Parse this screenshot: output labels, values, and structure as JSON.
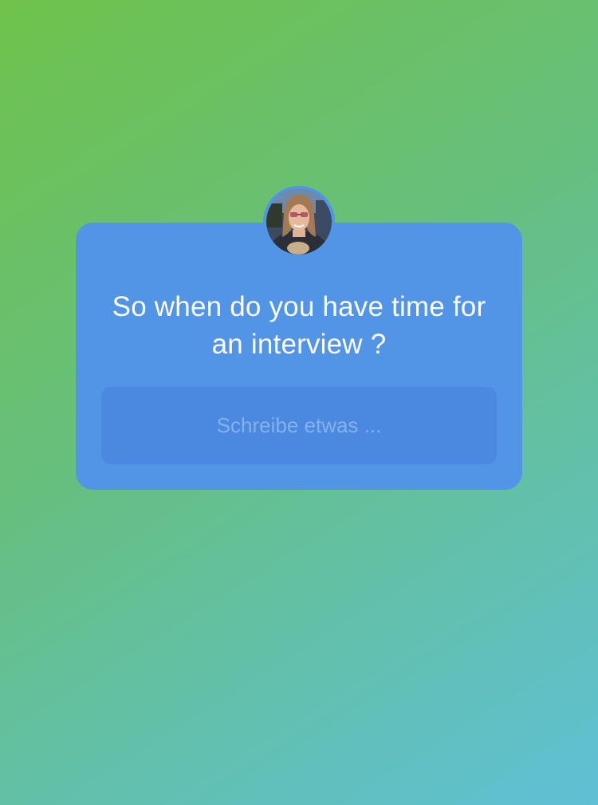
{
  "story": {
    "background_gradient": [
      "#6fc24b",
      "#67bf7c",
      "#62c0ac",
      "#5fc0d6"
    ]
  },
  "question_sticker": {
    "card_color": "#5294e6",
    "input_color": "#4a89df",
    "avatar_icon": "profile-photo-icon",
    "question_text": "So when do you have time for an interview ?",
    "answer_input": {
      "value": "",
      "placeholder": "Schreibe etwas ..."
    }
  }
}
